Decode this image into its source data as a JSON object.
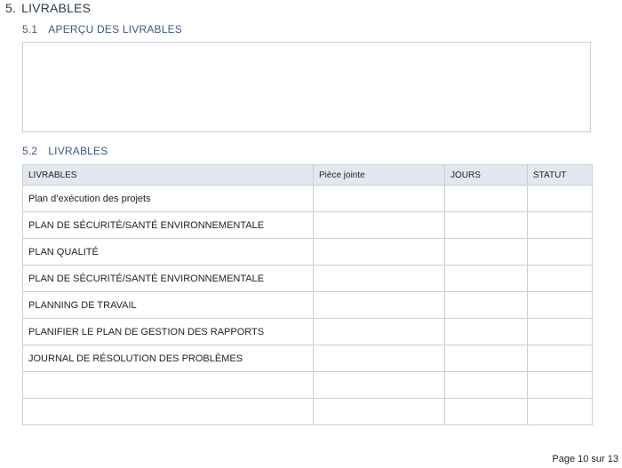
{
  "section": {
    "number": "5.",
    "title": "LIVRABLES"
  },
  "overview": {
    "number": "5.1",
    "title": "APERÇU DES LIVRABLES"
  },
  "deliverables": {
    "number": "5.2",
    "title": "LIVRABLES",
    "columns": [
      "LIVRABLES",
      "Pièce jointe",
      "JOURS",
      "STATUT"
    ],
    "rows": [
      [
        "Plan d’exécution des projets",
        "",
        "",
        ""
      ],
      [
        "PLAN DE SÉCURITÉ/SANTÉ ENVIRONNEMENTALE",
        "",
        "",
        ""
      ],
      [
        "PLAN QUALITÉ",
        "",
        "",
        ""
      ],
      [
        "PLAN DE SÉCURITÉ/SANTÉ ENVIRONNEMENTALE",
        "",
        "",
        ""
      ],
      [
        "PLANNING DE TRAVAIL",
        "",
        "",
        ""
      ],
      [
        "PLANIFIER LE PLAN DE GESTION DES RAPPORTS",
        "",
        "",
        ""
      ],
      [
        "JOURNAL DE RÉSOLUTION DES PROBLÈMES",
        "",
        "",
        ""
      ],
      [
        "",
        "",
        "",
        ""
      ],
      [
        "",
        "",
        "",
        ""
      ]
    ]
  },
  "footer": {
    "page_label": "Page 10 sur 13"
  }
}
